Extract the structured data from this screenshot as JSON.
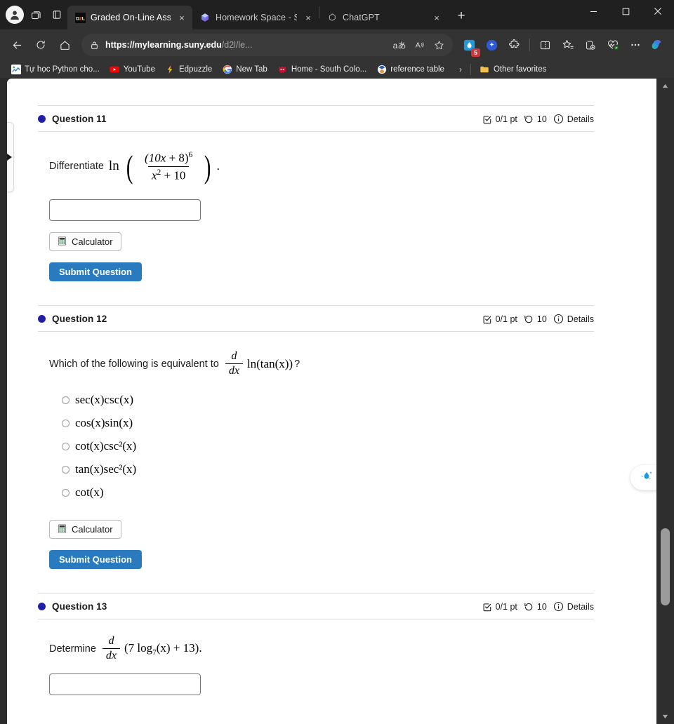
{
  "browser": {
    "profile_icon": "account-avatar-icon",
    "workspaces_icon": "workspaces-icon",
    "tab_actions_icon": "tab-actions-icon",
    "tabs": [
      {
        "title": "Graded On-Line Assignmen",
        "favicon": "d2l-icon",
        "active": true,
        "close": "×"
      },
      {
        "title": "Homework Space - StudyX",
        "favicon": "studyx-icon",
        "active": false,
        "close": "×"
      },
      {
        "title": "ChatGPT",
        "favicon": "chatgpt-icon",
        "active": false,
        "close": "×"
      }
    ],
    "new_tab_label": "+",
    "window_controls": {
      "minimize": "─",
      "maximize": "□",
      "close": "✕"
    },
    "nav": {
      "back": "back-arrow-icon",
      "refresh": "refresh-icon",
      "home": "home-icon"
    },
    "address": {
      "lock": "lock-icon",
      "url_domain": "https://mylearning.suny.edu",
      "url_path": "/d2l/le...",
      "url_full": "https://mylearning.suny.edu/d2l/le...",
      "translate": "aあ",
      "read_aloud": "read-aloud-icon",
      "favorite": "star-icon"
    },
    "toolbar": {
      "extension_badge": "5",
      "items": [
        "extension-water-icon",
        "copilot-sparkle-icon",
        "extensions-puzzle-icon",
        "split-screen-icon",
        "favorites-icon",
        "collections-icon",
        "browser-essentials-icon",
        "settings-more-icon",
        "copilot-icon"
      ]
    },
    "bookmarks": [
      {
        "label": "Tự học Python cho...",
        "icon": "python-course-icon"
      },
      {
        "label": "YouTube",
        "icon": "youtube-icon"
      },
      {
        "label": "Edpuzzle",
        "icon": "edpuzzle-icon"
      },
      {
        "label": "New Tab",
        "icon": "google-icon"
      },
      {
        "label": "Home - South Colo...",
        "icon": "school-mascot-icon"
      },
      {
        "label": "reference table",
        "icon": "reference-icon"
      }
    ],
    "bookmarks_overflow": "›",
    "other_favorites": {
      "label": "Other favorites",
      "icon": "folder-icon"
    }
  },
  "page": {
    "sidebar_toggle": "expand-sidebar-tab",
    "ai_widget": "ai-assistant-droplet-icon",
    "scrollbar": {
      "up": "▲",
      "down": "▼"
    },
    "questions": [
      {
        "title": "Question 11",
        "points": "0/1 pt",
        "attempts": "10",
        "details": "Details",
        "prompt_prefix": "Differentiate",
        "expr": {
          "kind": "ln-fraction",
          "ln": "ln",
          "numerator": "(10x + 8)",
          "numerator_exp": "6",
          "denominator_base": "x",
          "denominator_exp": "2",
          "denominator_rest": "+ 10",
          "trailing": "."
        },
        "input_value": "",
        "input_placeholder": "",
        "calculator_label": "Calculator",
        "submit_label": "Submit Question",
        "choices": []
      },
      {
        "title": "Question 12",
        "points": "0/1 pt",
        "attempts": "10",
        "details": "Details",
        "prompt_prefix": "Which of the following is equivalent to",
        "expr": {
          "kind": "ddx-ln-tan",
          "num": "d",
          "den_d": "d",
          "den_x": "x",
          "body": "ln(tan(x))",
          "trailing": "?"
        },
        "input_value": null,
        "calculator_label": "Calculator",
        "submit_label": "Submit Question",
        "choices": [
          {
            "label": "sec(x)csc(x)",
            "selected": false
          },
          {
            "label": "cos(x)sin(x)",
            "selected": false
          },
          {
            "label": "cot(x)csc²(x)",
            "selected": false
          },
          {
            "label": "tan(x)sec²(x)",
            "selected": false
          },
          {
            "label": "cot(x)",
            "selected": false
          }
        ]
      },
      {
        "title": "Question 13",
        "points": "0/1 pt",
        "attempts": "10",
        "details": "Details",
        "prompt_prefix": "Determine",
        "expr": {
          "kind": "ddx-log",
          "num": "d",
          "den_d": "d",
          "den_x": "x",
          "body_open": "(7 log",
          "body_sub": "7",
          "body_mid": "(x) + 13)",
          "trailing": "."
        },
        "input_value": "",
        "input_placeholder": "",
        "calculator_label": "",
        "submit_label": "",
        "choices": []
      }
    ]
  },
  "colors": {
    "accent_blue": "#2a7ac0",
    "question_dot": "#1f1fa8",
    "chrome_dark": "#333333",
    "tabstrip": "#202020",
    "badge_red": "#d13438"
  }
}
